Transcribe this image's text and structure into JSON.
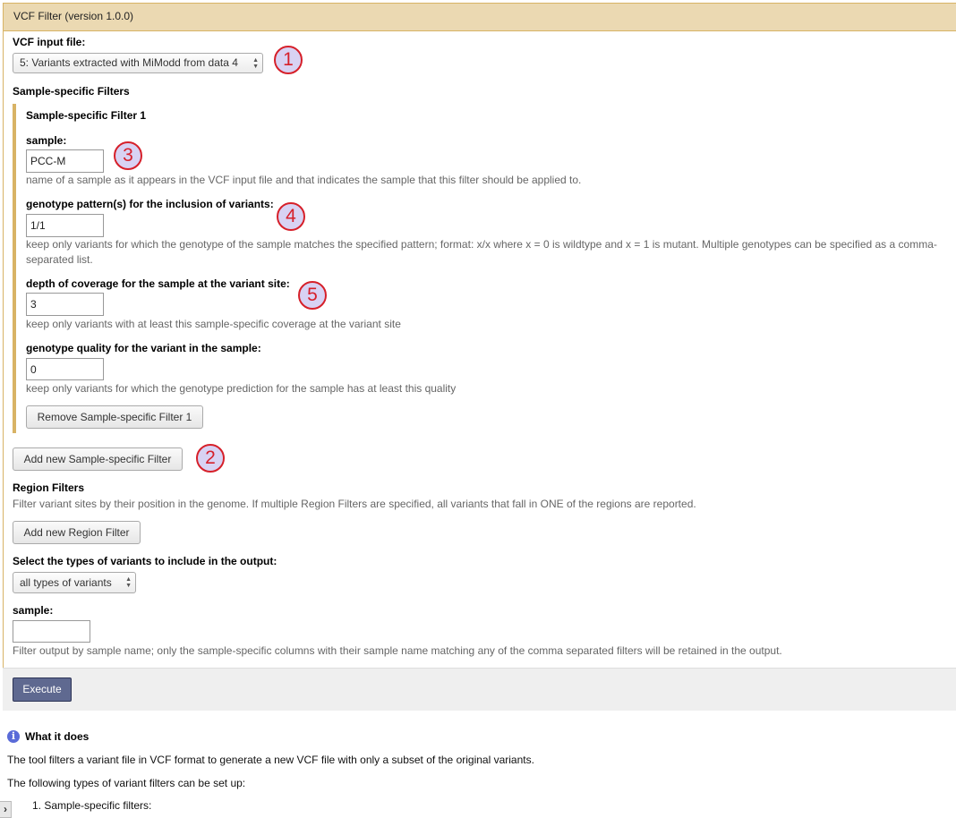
{
  "panel": {
    "title": "VCF Filter (version 1.0.0)"
  },
  "vcf_input": {
    "label": "VCF input file:",
    "selected": "5: Variants extracted with MiModd from data 4"
  },
  "sample_filters": {
    "heading": "Sample-specific Filters",
    "filter1": {
      "title": "Sample-specific Filter 1",
      "sample": {
        "label": "sample:",
        "value": "PCC-M",
        "help": "name of a sample as it appears in the VCF input file and that indicates the sample that this filter should be applied to."
      },
      "genotype": {
        "label": "genotype pattern(s) for the inclusion of variants:",
        "value": "1/1",
        "help": "keep only variants for which the genotype of the sample matches the specified pattern; format: x/x where x = 0 is wildtype and x = 1 is mutant. Multiple genotypes can be specified as a comma-separated list."
      },
      "depth": {
        "label": "depth of coverage for the sample at the variant site:",
        "value": "3",
        "help": "keep only variants with at least this sample-specific coverage at the variant site"
      },
      "gq": {
        "label": "genotype quality for the variant in the sample:",
        "value": "0",
        "help": "keep only variants for which the genotype prediction for the sample has at least this quality"
      },
      "remove_button": "Remove Sample-specific Filter 1"
    },
    "add_button": "Add new Sample-specific Filter"
  },
  "region_filters": {
    "heading": "Region Filters",
    "help": "Filter variant sites by their position in the genome. If multiple Region Filters are specified, all variants that fall in ONE of the regions are reported.",
    "add_button": "Add new Region Filter"
  },
  "variant_types": {
    "label": "Select the types of variants to include in the output:",
    "selected": "all types of variants"
  },
  "output_sample": {
    "label": "sample:",
    "value": "",
    "help": "Filter output by sample name; only the sample-specific columns with their sample name matching any of the comma separated filters will be retained in the output."
  },
  "execute_label": "Execute",
  "help_section": {
    "heading": "What it does",
    "para1": "The tool filters a variant file in VCF format to generate a new VCF file with only a subset of the original variants.",
    "para2": "The following types of variant filters can be set up:",
    "list_item1": "1. Sample-specific filters:"
  },
  "callouts": [
    "1",
    "2",
    "3",
    "4",
    "5"
  ],
  "icons": {
    "info": "info-icon",
    "collapse": "chevron-right-icon",
    "select_arrows": "updown-arrows-icon"
  },
  "colors": {
    "header_bg": "#ebd9b2",
    "accent_border": "#d8b365",
    "execute_bg": "#5f6990",
    "callout_red": "#d6202a",
    "callout_fill": "#d8d2f3"
  }
}
